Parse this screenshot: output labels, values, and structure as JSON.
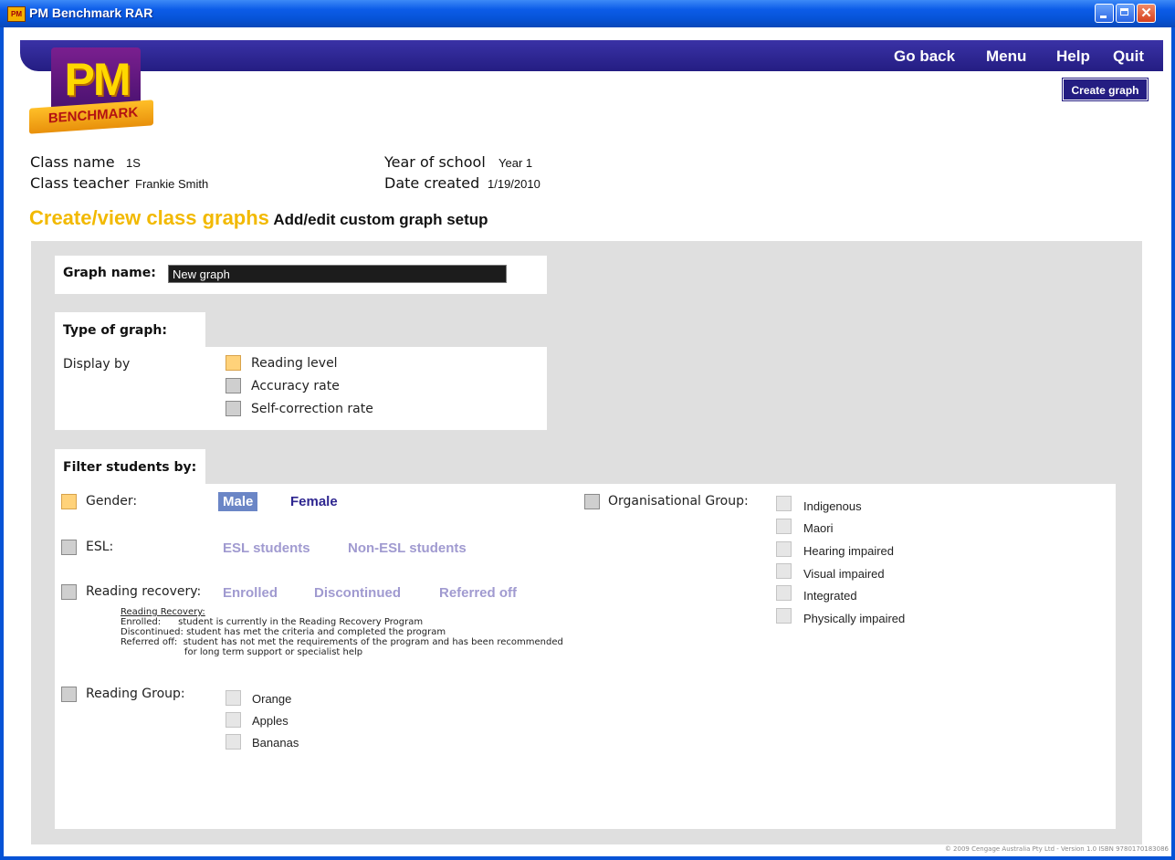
{
  "window": {
    "title": "PM Benchmark RAR",
    "icon_text": "PM",
    "controls": [
      "minimize",
      "maximize",
      "close"
    ],
    "close_glyph": "✕"
  },
  "nav": {
    "go_back": "Go back",
    "menu": "Menu",
    "help": "Help",
    "quit": "Quit"
  },
  "logo": {
    "top": "PM",
    "band": "BENCHMARK"
  },
  "toolbar": {
    "create_graph": "Create graph"
  },
  "class_info": {
    "class_name_label": "Class name",
    "class_name": "1S",
    "class_teacher_label": "Class teacher",
    "class_teacher": "Frankie Smith",
    "year_label": "Year of school",
    "year": "Year 1",
    "date_label": "Date created",
    "date": "1/19/2010"
  },
  "heading": {
    "primary": "Create/view class graphs",
    "secondary": "Add/edit custom graph setup"
  },
  "graph_name": {
    "label": "Graph name:",
    "value": "New graph"
  },
  "graph_type": {
    "title": "Type of graph:",
    "display_by_label": "Display by",
    "options": [
      {
        "label": "Reading level",
        "checked": true
      },
      {
        "label": "Accuracy rate",
        "checked": false
      },
      {
        "label": "Self-correction rate",
        "checked": false
      }
    ]
  },
  "filter": {
    "title": "Filter students by:",
    "gender": {
      "label": "Gender:",
      "checked": true,
      "male": "Male",
      "female": "Female",
      "selected": "Male"
    },
    "esl": {
      "label": "ESL:",
      "checked": false,
      "esl": "ESL students",
      "non_esl": "Non-ESL students"
    },
    "reading_recovery": {
      "label": "Reading recovery:",
      "checked": false,
      "enrolled": "Enrolled",
      "discontinued": "Discontinued",
      "referred_off": "Referred off",
      "note_title": "Reading Recovery:",
      "note_lines": [
        "Enrolled:      student is currently in the Reading Recovery Program",
        "Discontinued: student has met the criteria and completed the program",
        "Referred off:  student has not met the requirements of the program and has been recommended",
        "                      for long term support or specialist help"
      ]
    },
    "reading_group": {
      "label": "Reading Group:",
      "checked": false,
      "options": [
        "Orange",
        "Apples",
        "Bananas"
      ]
    },
    "org_group": {
      "label": "Organisational Group:",
      "checked": false,
      "options": [
        "Indigenous",
        "Maori",
        "Hearing impaired",
        "Visual impaired",
        "Integrated",
        "Physically impaired"
      ]
    }
  },
  "footer": "© 2009 Cengage Australia Pty Ltd - Version 1.0 ISBN 9780170183086",
  "colors": {
    "nav_bg": "#241d82",
    "accent_yellow": "#f2b900",
    "checked_box": "#ffd27a",
    "selected_filter": "#6b86c6",
    "inactive_filter": "#a09ad0",
    "panel_bg": "#dfdfdf"
  }
}
